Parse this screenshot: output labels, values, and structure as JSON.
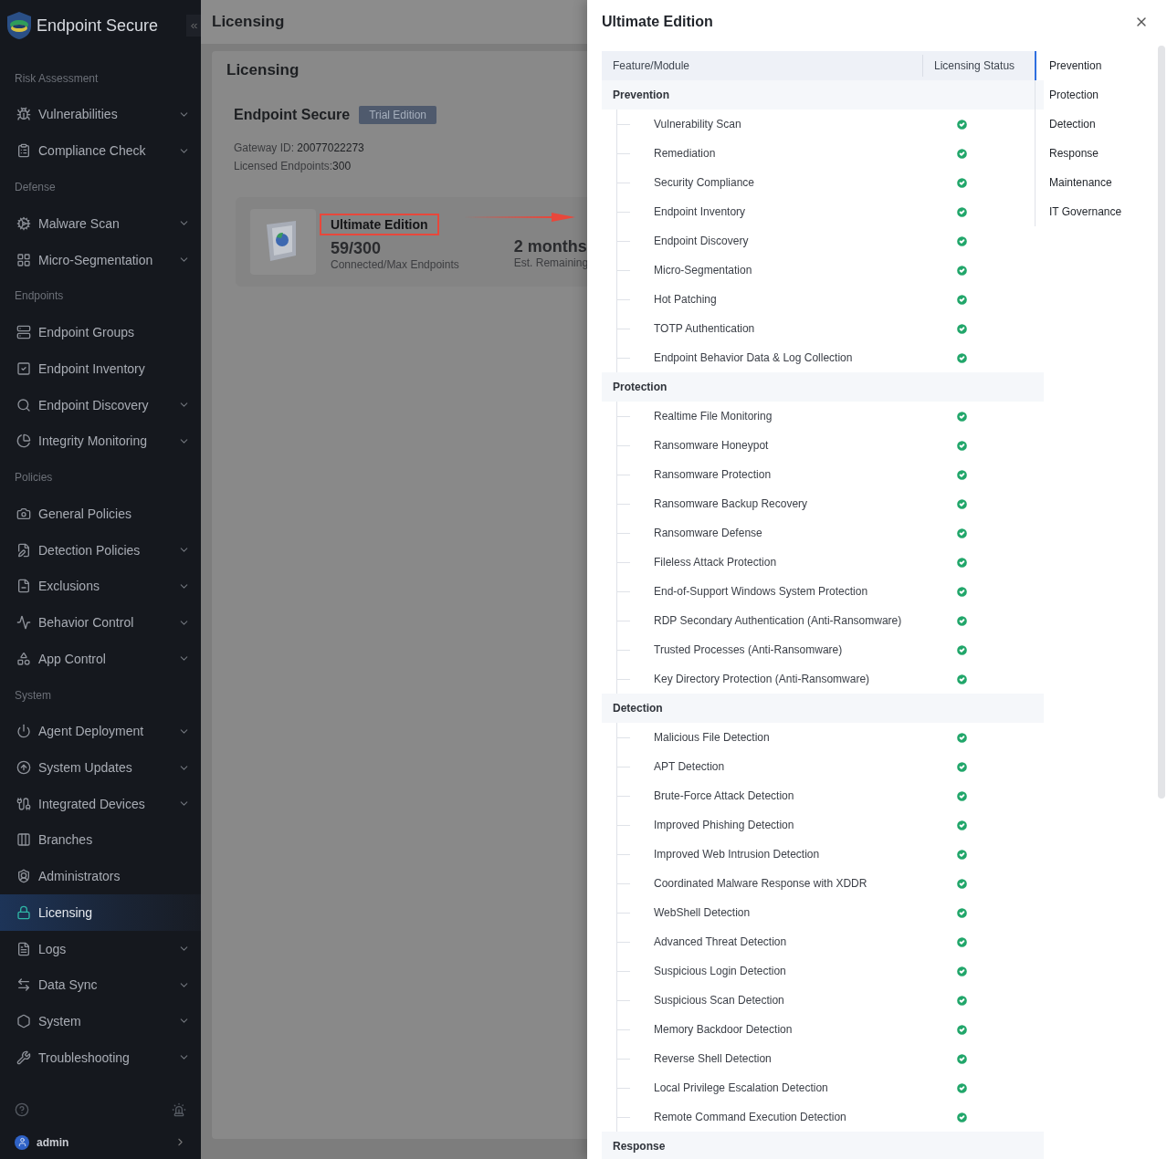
{
  "app": {
    "name": "Endpoint Secure"
  },
  "sidebar": {
    "sections": [
      {
        "title": "Risk Assessment",
        "items": [
          {
            "label": "Vulnerabilities",
            "expandable": true,
            "selected": false
          },
          {
            "label": "Compliance Check",
            "expandable": true,
            "selected": false
          }
        ]
      },
      {
        "title": "Defense",
        "items": [
          {
            "label": "Malware Scan",
            "expandable": true,
            "selected": false
          },
          {
            "label": "Micro-Segmentation",
            "expandable": true,
            "selected": false
          }
        ]
      },
      {
        "title": "Endpoints",
        "items": [
          {
            "label": "Endpoint Groups",
            "expandable": false,
            "selected": false
          },
          {
            "label": "Endpoint Inventory",
            "expandable": false,
            "selected": false
          },
          {
            "label": "Endpoint Discovery",
            "expandable": true,
            "selected": false
          },
          {
            "label": "Integrity Monitoring",
            "expandable": true,
            "selected": false
          }
        ]
      },
      {
        "title": "Policies",
        "items": [
          {
            "label": "General Policies",
            "expandable": false,
            "selected": false
          },
          {
            "label": "Detection Policies",
            "expandable": true,
            "selected": false
          },
          {
            "label": "Exclusions",
            "expandable": true,
            "selected": false
          },
          {
            "label": "Behavior Control",
            "expandable": true,
            "selected": false
          },
          {
            "label": "App Control",
            "expandable": true,
            "selected": false
          }
        ]
      },
      {
        "title": "System",
        "items": [
          {
            "label": "Agent Deployment",
            "expandable": true,
            "selected": false
          },
          {
            "label": "System Updates",
            "expandable": true,
            "selected": false
          },
          {
            "label": "Integrated Devices",
            "expandable": true,
            "selected": false
          },
          {
            "label": "Branches",
            "expandable": false,
            "selected": false
          },
          {
            "label": "Administrators",
            "expandable": false,
            "selected": false
          },
          {
            "label": "Licensing",
            "expandable": false,
            "selected": true
          },
          {
            "label": "Logs",
            "expandable": true,
            "selected": false
          },
          {
            "label": "Data Sync",
            "expandable": true,
            "selected": false
          },
          {
            "label": "System",
            "expandable": true,
            "selected": false
          },
          {
            "label": "Troubleshooting",
            "expandable": true,
            "selected": false
          }
        ]
      }
    ],
    "user": "admin"
  },
  "page": {
    "title": "Licensing",
    "card_title": "Licensing",
    "product": "Endpoint Secure",
    "edition_badge": "Trial Edition",
    "gateway_label": "Gateway ID: ",
    "gateway_id": "20077022273",
    "endpoints_label": "Licensed Endpoints:",
    "endpoints_value": "300",
    "license": {
      "edition": "Ultimate Edition",
      "usage": "59/300",
      "usage_caption": "Connected/Max Endpoints",
      "remaining": "2 months",
      "remaining_caption": "Est. Remaining"
    }
  },
  "drawer": {
    "title": "Ultimate Edition",
    "columns": [
      "Feature/Module",
      "Licensing Status"
    ],
    "groups": [
      {
        "name": "Prevention",
        "features": [
          {
            "name": "Vulnerability Scan",
            "licensed": true
          },
          {
            "name": "Remediation",
            "licensed": true
          },
          {
            "name": "Security Compliance",
            "licensed": true
          },
          {
            "name": "Endpoint Inventory",
            "licensed": true
          },
          {
            "name": "Endpoint Discovery",
            "licensed": true
          },
          {
            "name": "Micro-Segmentation",
            "licensed": true
          },
          {
            "name": "Hot Patching",
            "licensed": true
          },
          {
            "name": "TOTP Authentication",
            "licensed": true
          },
          {
            "name": "Endpoint Behavior Data & Log Collection",
            "licensed": true
          }
        ]
      },
      {
        "name": "Protection",
        "features": [
          {
            "name": "Realtime File Monitoring",
            "licensed": true
          },
          {
            "name": "Ransomware Honeypot",
            "licensed": true
          },
          {
            "name": "Ransomware Protection",
            "licensed": true
          },
          {
            "name": "Ransomware Backup Recovery",
            "licensed": true
          },
          {
            "name": "Ransomware Defense",
            "licensed": true
          },
          {
            "name": "Fileless Attack Protection",
            "licensed": true
          },
          {
            "name": "End-of-Support Windows System Protection",
            "licensed": true
          },
          {
            "name": "RDP Secondary Authentication (Anti-Ransomware)",
            "licensed": true
          },
          {
            "name": "Trusted Processes (Anti-Ransomware)",
            "licensed": true
          },
          {
            "name": "Key Directory Protection (Anti-Ransomware)",
            "licensed": true
          }
        ]
      },
      {
        "name": "Detection",
        "features": [
          {
            "name": "Malicious File Detection",
            "licensed": true
          },
          {
            "name": "APT Detection",
            "licensed": true
          },
          {
            "name": "Brute-Force Attack Detection",
            "licensed": true
          },
          {
            "name": "Improved Phishing Detection",
            "licensed": true
          },
          {
            "name": "Improved Web Intrusion Detection",
            "licensed": true
          },
          {
            "name": "Coordinated Malware Response with XDDR",
            "licensed": true
          },
          {
            "name": "WebShell Detection",
            "licensed": true
          },
          {
            "name": "Advanced Threat Detection",
            "licensed": true
          },
          {
            "name": "Suspicious Login Detection",
            "licensed": true
          },
          {
            "name": "Suspicious Scan Detection",
            "licensed": true
          },
          {
            "name": "Memory Backdoor Detection",
            "licensed": true
          },
          {
            "name": "Reverse Shell Detection",
            "licensed": true
          },
          {
            "name": "Local Privilege Escalation Detection",
            "licensed": true
          },
          {
            "name": "Remote Command Execution Detection",
            "licensed": true
          }
        ]
      },
      {
        "name": "Response"
      }
    ],
    "nav": [
      {
        "label": "Prevention",
        "selected": true
      },
      {
        "label": "Protection",
        "selected": false
      },
      {
        "label": "Detection",
        "selected": false
      },
      {
        "label": "Response",
        "selected": false
      },
      {
        "label": "Maintenance",
        "selected": false
      },
      {
        "label": "IT Governance",
        "selected": false
      }
    ]
  }
}
